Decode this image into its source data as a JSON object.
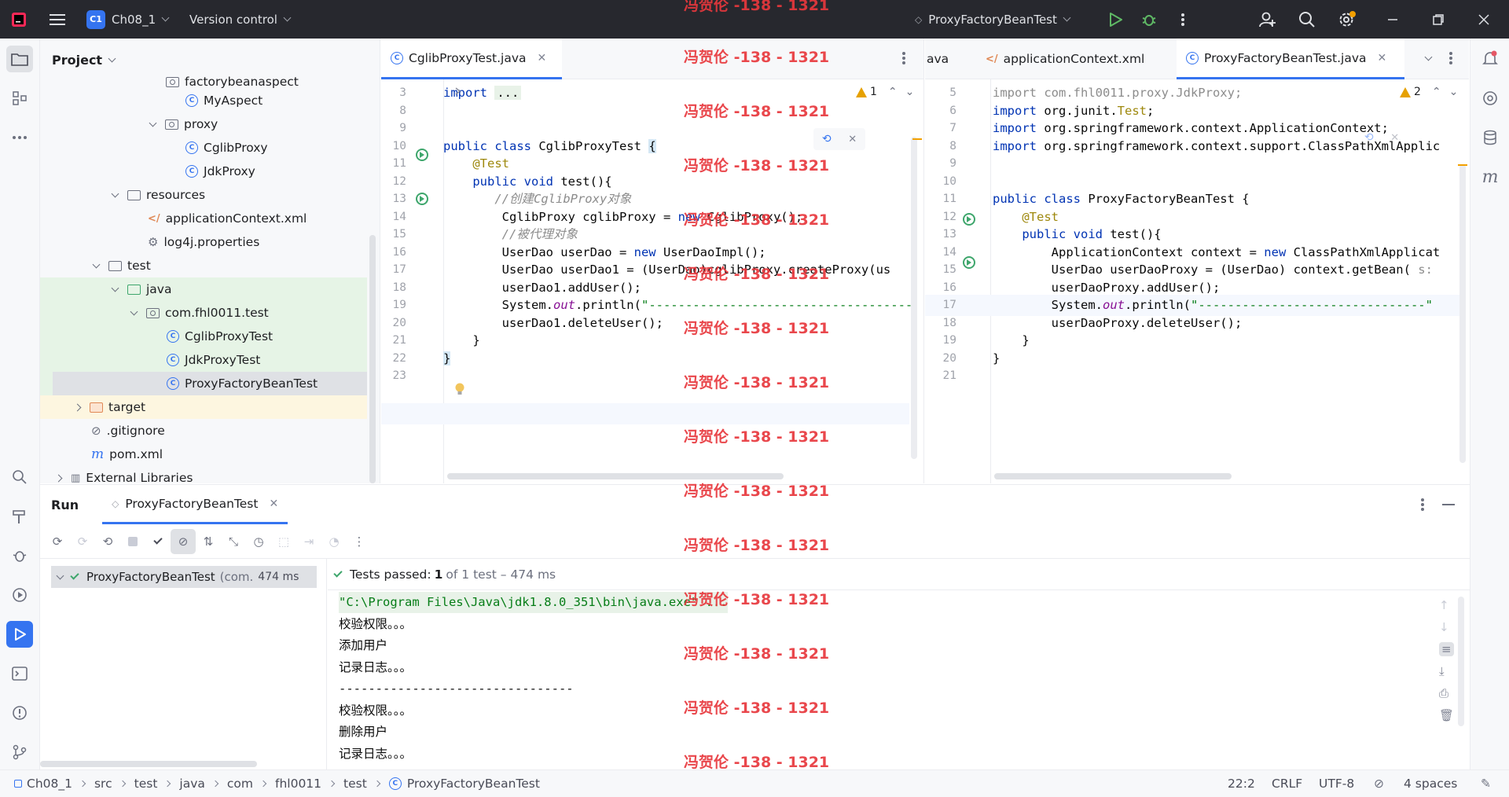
{
  "titlebar": {
    "project_badge": "C1",
    "project_name": "Ch08_1",
    "vcs_label": "Version control",
    "run_config": "ProxyFactoryBeanTest"
  },
  "project_panel": {
    "title": "Project",
    "items": [
      {
        "label": "factorybeanaspect",
        "type": "package"
      },
      {
        "label": "MyAspect",
        "type": "class"
      },
      {
        "label": "proxy",
        "type": "package"
      },
      {
        "label": "CglibProxy",
        "type": "class"
      },
      {
        "label": "JdkProxy",
        "type": "class"
      },
      {
        "label": "resources",
        "type": "folder"
      },
      {
        "label": "applicationContext.xml",
        "type": "xml"
      },
      {
        "label": "log4j.properties",
        "type": "properties"
      },
      {
        "label": "test",
        "type": "folder"
      },
      {
        "label": "java",
        "type": "folder"
      },
      {
        "label": "com.fhl0011.test",
        "type": "package"
      },
      {
        "label": "CglibProxyTest",
        "type": "class"
      },
      {
        "label": "JdkProxyTest",
        "type": "class"
      },
      {
        "label": "ProxyFactoryBeanTest",
        "type": "class"
      },
      {
        "label": "target",
        "type": "folder"
      },
      {
        "label": ".gitignore",
        "type": "ignore"
      },
      {
        "label": "pom.xml",
        "type": "maven"
      },
      {
        "label": "External Libraries",
        "type": "library"
      }
    ]
  },
  "editor_left": {
    "tab": "CglibProxyTest.java",
    "warning_count": "1",
    "line_numbers": [
      "3",
      "8",
      "9",
      "10",
      "11",
      "12",
      "13",
      "14",
      "15",
      "16",
      "17",
      "18",
      "19",
      "20",
      "21",
      "22",
      "23"
    ],
    "code": [
      {
        "parts": [
          {
            "t": "import ",
            "c": "kw"
          },
          {
            "t": "...",
            "c": "fold"
          }
        ]
      },
      {
        "parts": []
      },
      {
        "parts": []
      },
      {
        "parts": [
          {
            "t": "public class ",
            "c": "kw"
          },
          {
            "t": "CglibProxyTest ",
            "c": ""
          },
          {
            "t": "{",
            "c": "brace"
          }
        ]
      },
      {
        "parts": [
          {
            "t": "    @Test",
            "c": "ann"
          }
        ]
      },
      {
        "parts": [
          {
            "t": "    public void ",
            "c": "kw"
          },
          {
            "t": "test(){",
            "c": ""
          }
        ]
      },
      {
        "parts": [
          {
            "t": "       //创建CglibProxy对象",
            "c": "cm"
          }
        ]
      },
      {
        "parts": [
          {
            "t": "        CglibProxy cglibProxy = ",
            "c": ""
          },
          {
            "t": "new ",
            "c": "kw"
          },
          {
            "t": "CglibProxy();",
            "c": ""
          }
        ]
      },
      {
        "parts": [
          {
            "t": "        //被代理对象",
            "c": "cm"
          }
        ]
      },
      {
        "parts": [
          {
            "t": "        UserDao userDao = ",
            "c": ""
          },
          {
            "t": "new ",
            "c": "kw"
          },
          {
            "t": "UserDaoImpl();",
            "c": ""
          }
        ]
      },
      {
        "parts": [
          {
            "t": "        UserDao userDao1 = (UserDao)cglibProxy.createProxy(us",
            "c": ""
          }
        ]
      },
      {
        "parts": [
          {
            "t": "        userDao1.addUser();",
            "c": ""
          }
        ]
      },
      {
        "parts": [
          {
            "t": "        System.",
            "c": ""
          },
          {
            "t": "out",
            "c": "fld"
          },
          {
            "t": ".println(",
            "c": ""
          },
          {
            "t": "\"------------------------------------",
            "c": "str"
          }
        ]
      },
      {
        "parts": [
          {
            "t": "        userDao1.deleteUser();",
            "c": ""
          }
        ]
      },
      {
        "parts": [
          {
            "t": "    }",
            "c": ""
          }
        ]
      },
      {
        "parts": [
          {
            "t": "}",
            "c": "brace"
          }
        ]
      },
      {
        "parts": []
      }
    ]
  },
  "editor_right": {
    "tabs": [
      "ava",
      "applicationContext.xml",
      "ProxyFactoryBeanTest.java"
    ],
    "warning_count": "2",
    "line_numbers": [
      "5",
      "6",
      "7",
      "8",
      "9",
      "10",
      "11",
      "12",
      "13",
      "14",
      "15",
      "16",
      "17",
      "18",
      "19",
      "20",
      "21"
    ],
    "code": [
      {
        "parts": [
          {
            "t": "import com.fhl0011.proxy.JdkProxy;",
            "c": "muted"
          }
        ]
      },
      {
        "parts": [
          {
            "t": "import ",
            "c": "kw"
          },
          {
            "t": "org.junit.",
            "c": ""
          },
          {
            "t": "Test",
            "c": "ann"
          },
          {
            "t": ";",
            "c": ""
          }
        ]
      },
      {
        "parts": [
          {
            "t": "import ",
            "c": "kw"
          },
          {
            "t": "org.springframework.context.ApplicationContext;",
            "c": ""
          }
        ]
      },
      {
        "parts": [
          {
            "t": "import ",
            "c": "kw"
          },
          {
            "t": "org.springframework.context.support.ClassPathXmlApplic",
            "c": ""
          }
        ]
      },
      {
        "parts": []
      },
      {
        "parts": []
      },
      {
        "parts": [
          {
            "t": "public class ",
            "c": "kw"
          },
          {
            "t": "ProxyFactoryBeanTest {",
            "c": ""
          }
        ]
      },
      {
        "parts": [
          {
            "t": "    @Test",
            "c": "ann"
          }
        ]
      },
      {
        "parts": [
          {
            "t": "    public void ",
            "c": "kw"
          },
          {
            "t": "test(){",
            "c": ""
          }
        ]
      },
      {
        "parts": [
          {
            "t": "        ApplicationContext context = ",
            "c": ""
          },
          {
            "t": "new ",
            "c": "kw"
          },
          {
            "t": "ClassPathXmlApplicat",
            "c": ""
          }
        ]
      },
      {
        "parts": [
          {
            "t": "        UserDao userDaoProxy = (UserDao) context.getBean( ",
            "c": ""
          },
          {
            "t": "s:",
            "c": "muted"
          }
        ]
      },
      {
        "parts": [
          {
            "t": "        userDaoProxy.addUser();",
            "c": ""
          }
        ]
      },
      {
        "parts": [
          {
            "t": "        System.",
            "c": ""
          },
          {
            "t": "out",
            "c": "fld"
          },
          {
            "t": ".println(",
            "c": ""
          },
          {
            "t": "\"-------------------------------\"",
            "c": "str"
          }
        ]
      },
      {
        "parts": [
          {
            "t": "        userDaoProxy.deleteUser();",
            "c": ""
          }
        ]
      },
      {
        "parts": [
          {
            "t": "    }",
            "c": ""
          }
        ]
      },
      {
        "parts": [
          {
            "t": "}",
            "c": ""
          }
        ]
      },
      {
        "parts": []
      }
    ]
  },
  "run_panel": {
    "title": "Run",
    "tab": "ProxyFactoryBeanTest",
    "test_tree": {
      "name": "ProxyFactoryBeanTest",
      "package": "(com.",
      "time": "474 ms"
    },
    "status": {
      "prefix": "Tests passed: ",
      "count": "1",
      "suffix": " of 1 test – 474 ms"
    },
    "console": [
      "\"C:\\Program Files\\Java\\jdk1.8.0_351\\bin\\java.exe\" ...",
      "校验权限。。。",
      "添加用户",
      "记录日志。。。",
      "--------------------------------",
      "校验权限。。。",
      "删除用户",
      "记录日志。。。"
    ]
  },
  "statusbar": {
    "breadcrumbs": [
      "Ch08_1",
      "src",
      "test",
      "java",
      "com",
      "fhl0011",
      "test",
      "ProxyFactoryBeanTest"
    ],
    "position": "22:2",
    "line_sep": "CRLF",
    "encoding": "UTF-8",
    "indent": "4 spaces"
  },
  "watermark": "冯贺伦 -138 - 1321",
  "colors": {
    "accent": "#3574f0",
    "run_green": "#3ea66c",
    "watermark": "#e8383d"
  }
}
